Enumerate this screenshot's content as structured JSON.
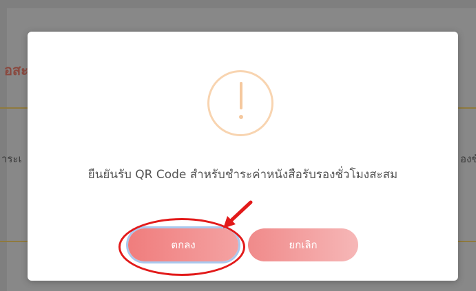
{
  "background": {
    "heading_fragment": "อสะ",
    "left_text_fragment": "ำระเ",
    "right_text_fragment": "องชั่"
  },
  "dialog": {
    "icon": "exclamation-icon",
    "message": "ยืนยันรับ QR Code สำหรับชำระค่าหนังสือรับรองชั่วโมงสะสม",
    "confirm_label": "ตกลง",
    "cancel_label": "ยกเลิก"
  },
  "colors": {
    "button_gradient_start": "#f07d7d",
    "button_gradient_end": "#f4a2a2",
    "warning_icon": "#f5c89e",
    "annotation": "#e21a1a"
  }
}
